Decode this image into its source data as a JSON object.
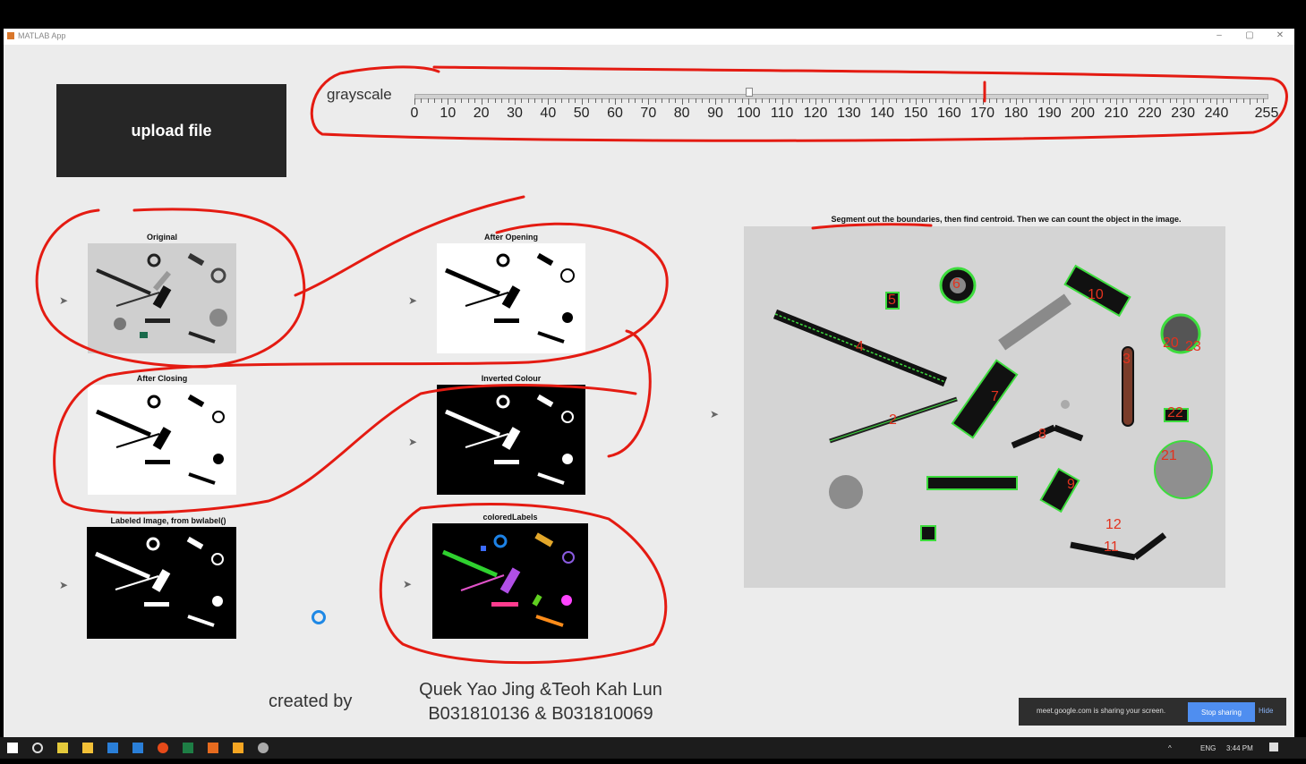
{
  "window": {
    "title": "MATLAB App",
    "minimize": "–",
    "maximize": "▢",
    "close": "✕"
  },
  "upload_button": "upload file",
  "slider": {
    "label": "grayscale",
    "ticks": [
      "0",
      "10",
      "20",
      "30",
      "40",
      "50",
      "60",
      "70",
      "80",
      "90",
      "100",
      "110",
      "120",
      "130",
      "140",
      "150",
      "160",
      "170",
      "180",
      "190",
      "200",
      "210",
      "220",
      "230",
      "240",
      "255"
    ],
    "value": 100,
    "min": 0,
    "max": 255
  },
  "panels": [
    {
      "title": "Original"
    },
    {
      "title": "After Opening"
    },
    {
      "title": "After Closing"
    },
    {
      "title": "Inverted Colour"
    },
    {
      "title": "Labeled Image, from bwlabel()"
    },
    {
      "title": "coloredLabels"
    }
  ],
  "main_plot": {
    "title": "Segment out the boundaries, then find centroid. Then we can count the object in the image.",
    "labels": [
      "6",
      "5",
      "10",
      "4",
      "20",
      "23",
      "7",
      "2",
      "8",
      "22",
      "3",
      "21",
      "9",
      "12",
      "11"
    ]
  },
  "credits": {
    "created_by": "created by",
    "names": "Quek Yao Jing &Teoh Kah Lun",
    "ids": "B031810136 & B031810069"
  },
  "share_bar": {
    "text": "meet.google.com is sharing your screen.",
    "stop": "Stop sharing",
    "hide": "Hide"
  },
  "taskbar": {
    "lang": "ENG",
    "time": "3:44 PM"
  },
  "colors": {
    "annotation": "#e41b12",
    "button": "#262626",
    "window_bg": "#ececec"
  }
}
